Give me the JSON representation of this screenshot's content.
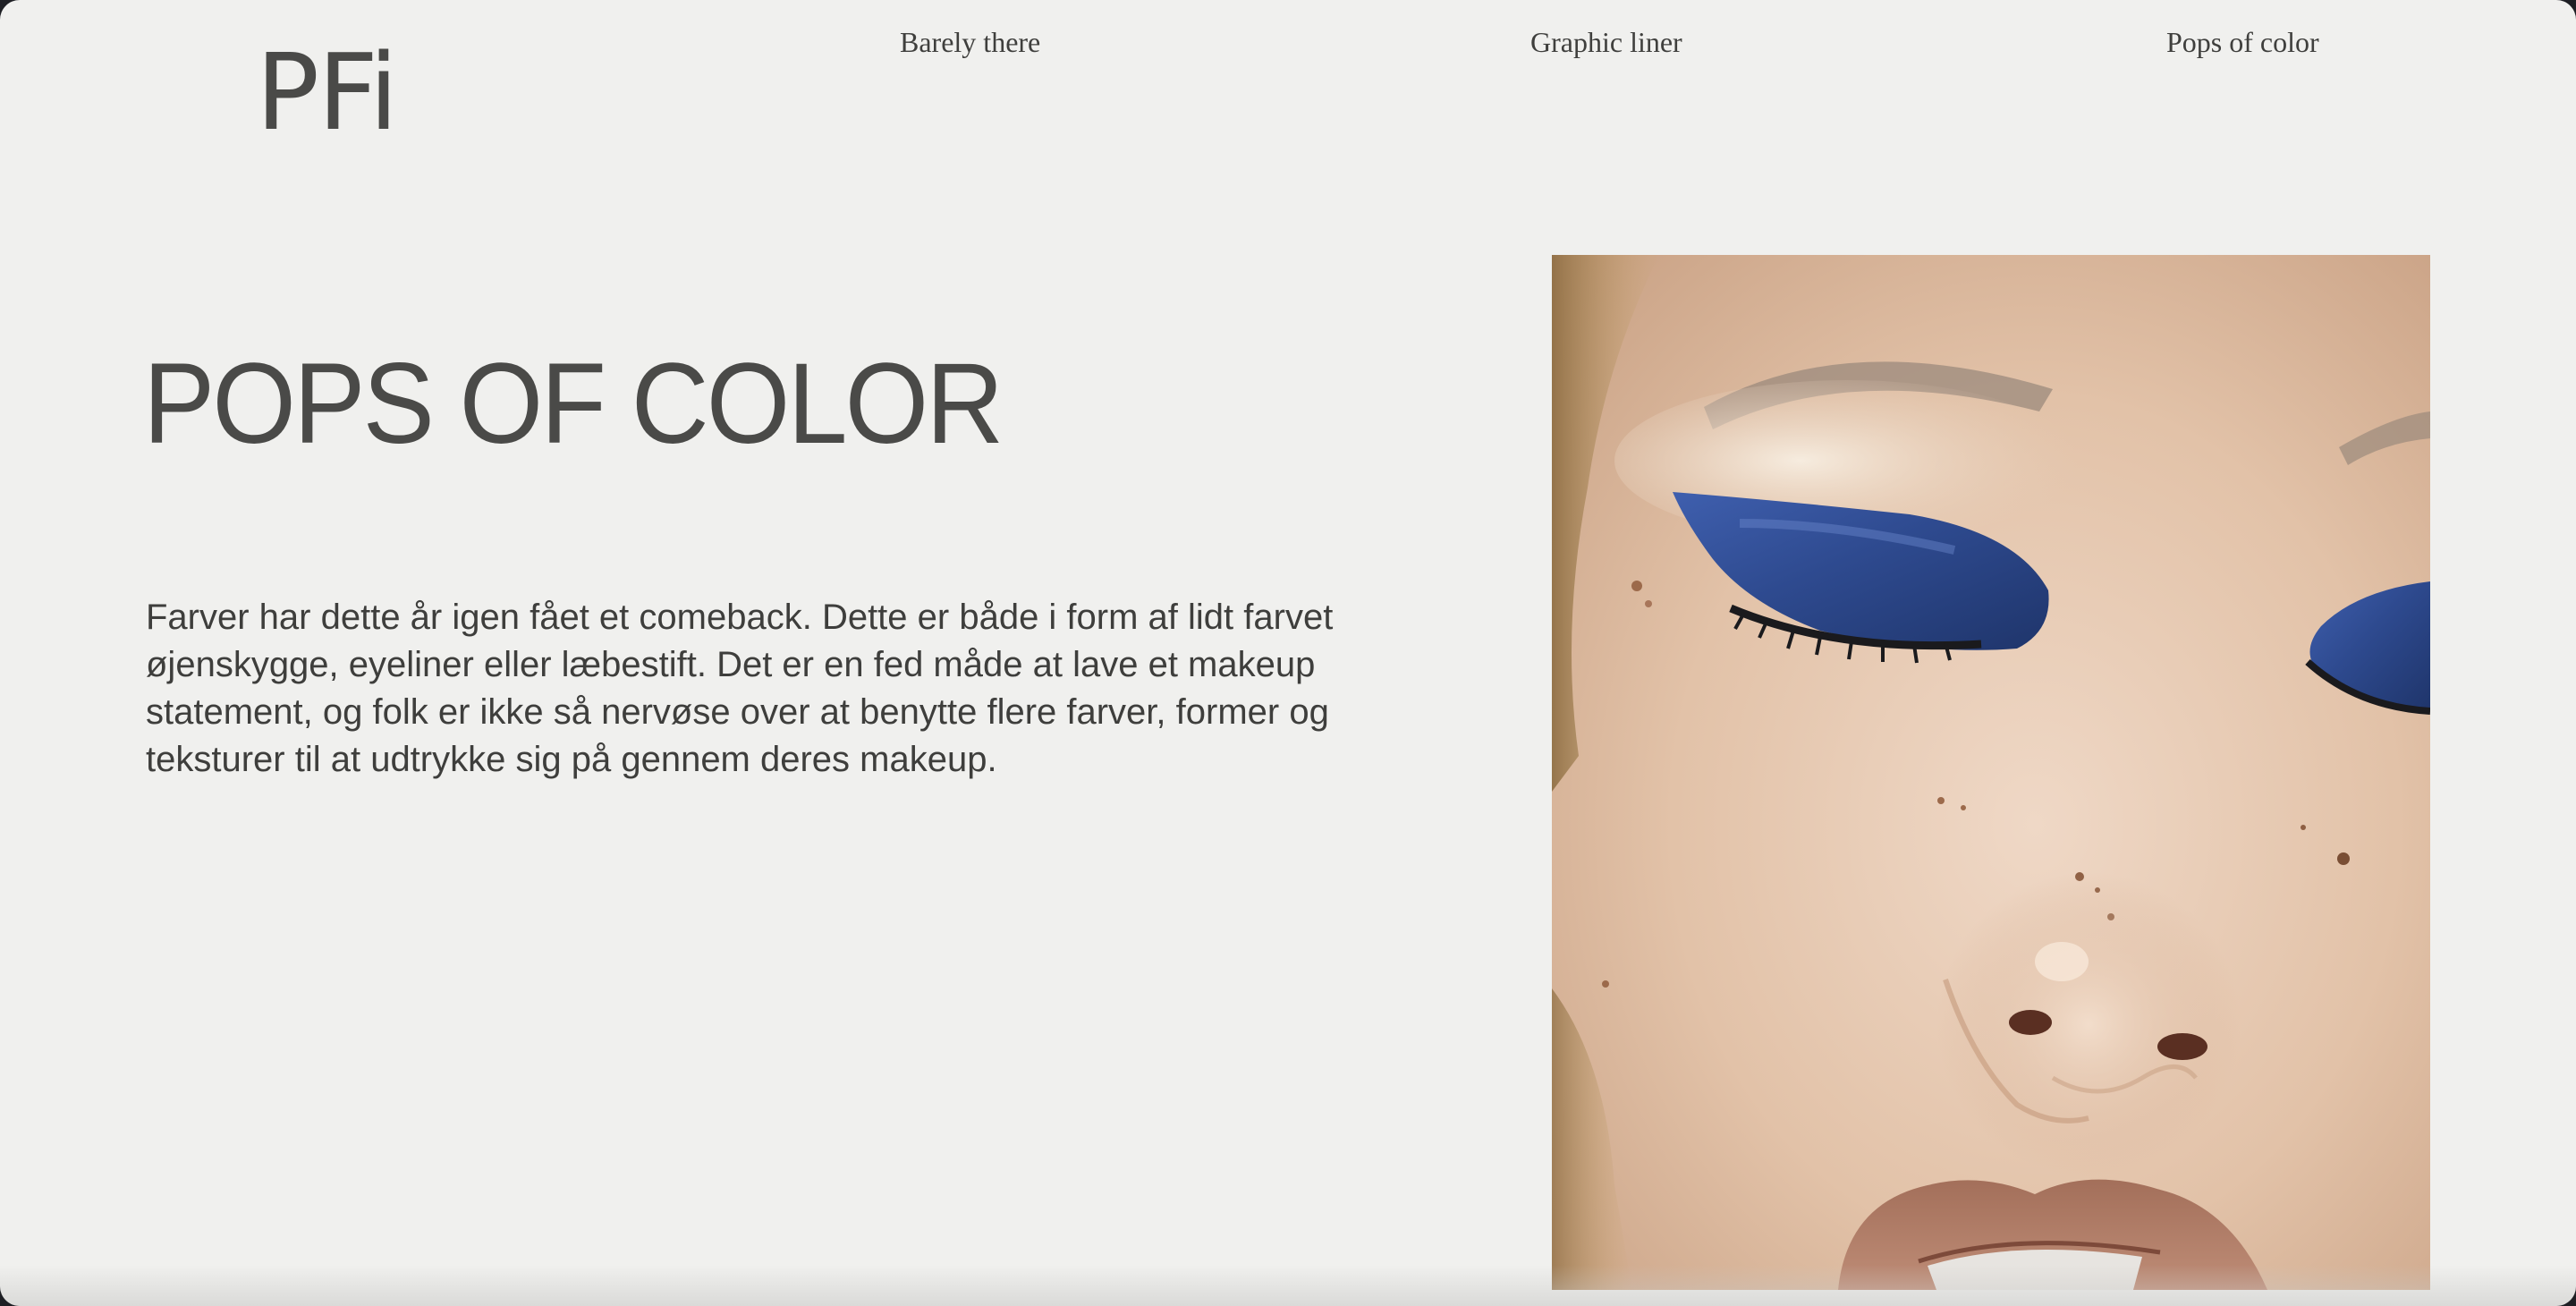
{
  "brand": {
    "logo_text": "PFi"
  },
  "nav": {
    "items": [
      {
        "label": "Barely there"
      },
      {
        "label": "Graphic liner"
      },
      {
        "label": "Pops of color"
      }
    ]
  },
  "main": {
    "headline": "POPS OF COLOR",
    "paragraph": "Farver har dette år igen fået et comeback. Dette er både i form af lidt farvet øjenskygge, eyeliner eller læbestift. Det er en fed måde at lave et makeup statement, og folk er ikke så nervøse over at benytte flere farver, former og teksturer til at udtrykke sig på gennem deres makeup."
  },
  "colors": {
    "page_background": "#f0f0ee",
    "text": "#4a4a48",
    "eyeshadow_blue": "#2e4a8f",
    "skin": "#e2c2a8",
    "lips": "#b07d68"
  },
  "image": {
    "subject": "close-up-face-blue-graphic-eyeshadow"
  }
}
